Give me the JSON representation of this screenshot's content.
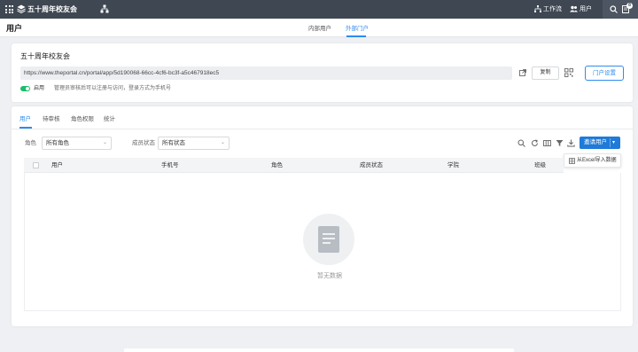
{
  "app": {
    "title": "五十周年校友会",
    "caret": "⌄"
  },
  "topnav": {
    "workflow": "工作流",
    "users": "用户",
    "badge": "8"
  },
  "page": {
    "title": "用户",
    "tabs": [
      {
        "label": "内部用户",
        "active": false
      },
      {
        "label": "外部门户",
        "active": true
      }
    ]
  },
  "portal": {
    "name": "五十周年校友会",
    "url": "https://www.theportal.cn/portal/app/5d190068-66cc-4cf6-bc3f-a5c467918ec5",
    "copy_label": "复制",
    "settings_label": "门户设置",
    "enabled": true,
    "enable_label": "启用",
    "enable_hint": "管理员审核后可以注册与访问，登录方式为手机号"
  },
  "panel": {
    "tabs": [
      {
        "label": "用户",
        "active": true
      },
      {
        "label": "待审核"
      },
      {
        "label": "角色权限"
      },
      {
        "label": "统计"
      }
    ],
    "filters": {
      "role_label": "角色",
      "role_value": "所有角色",
      "status_label": "成员状态",
      "status_value": "所有状态"
    },
    "invite_label": "邀请用户",
    "dropdown_item": "从Excel导入数据",
    "columns": [
      "用户",
      "手机号",
      "角色",
      "成员状态",
      "学院",
      "班级"
    ],
    "empty_text": "暂无数据"
  },
  "colors": {
    "accent": "#2d8cf0",
    "topbar": "#3e4752",
    "success": "#19be6b"
  }
}
